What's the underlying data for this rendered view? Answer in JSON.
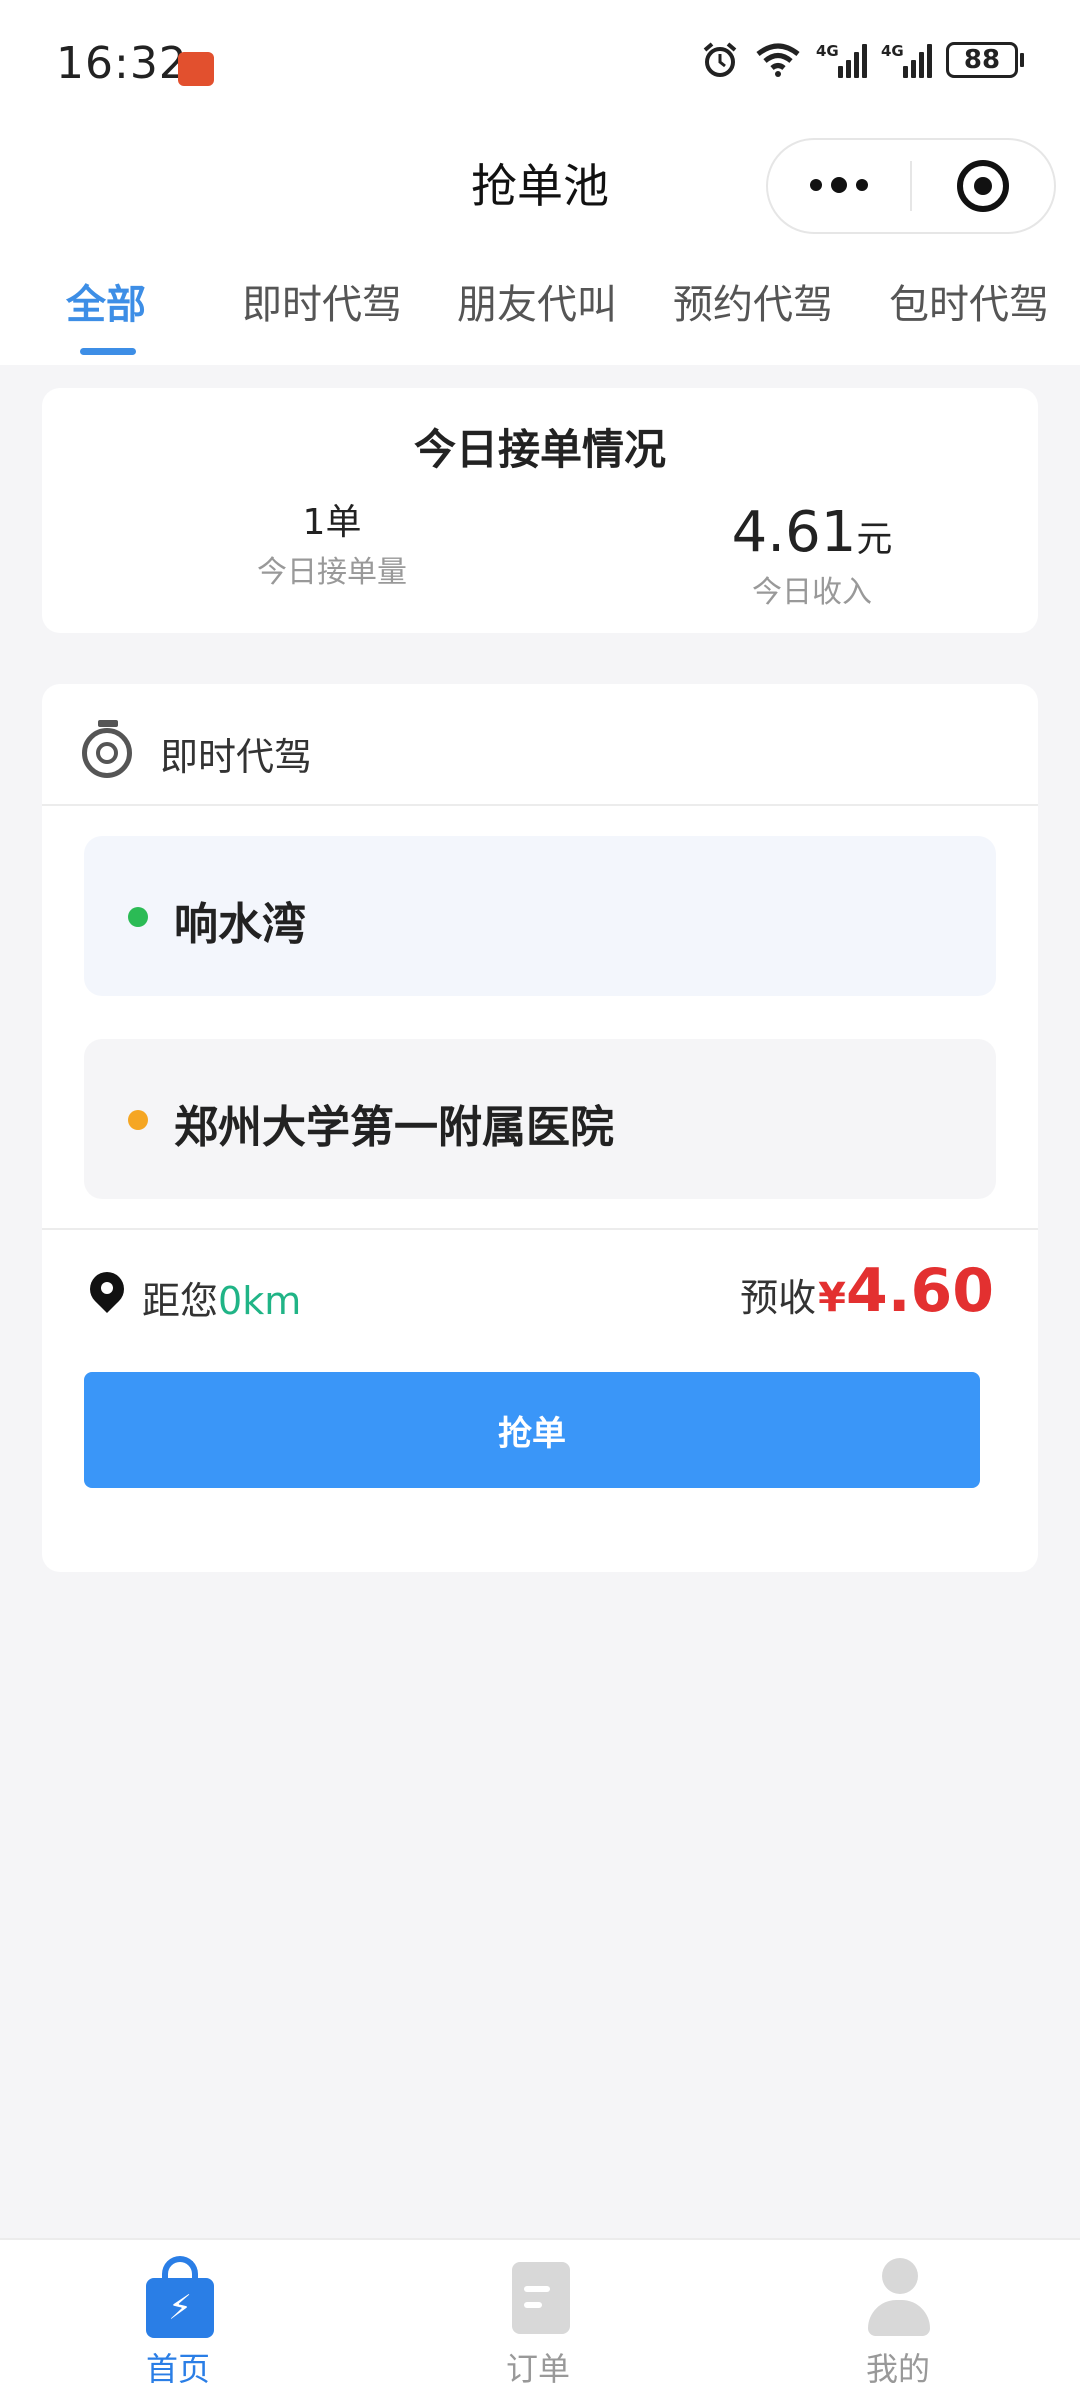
{
  "status_bar": {
    "time": "16:32",
    "network_1": "4G",
    "network_2": "4G",
    "battery": "88",
    "icons": [
      "app-notification-icon",
      "alarm-icon",
      "wifi-icon",
      "signal-icon",
      "signal-icon",
      "battery-icon"
    ]
  },
  "header": {
    "title": "抢单池",
    "capsule_icons": [
      "more-icon",
      "close-target-icon"
    ]
  },
  "tabs": [
    {
      "label": "全部",
      "active": true
    },
    {
      "label": "即时代驾",
      "active": false
    },
    {
      "label": "朋友代叫",
      "active": false
    },
    {
      "label": "预约代驾",
      "active": false
    },
    {
      "label": "包时代驾",
      "active": false
    }
  ],
  "today_stats": {
    "title": "今日接单情况",
    "orders_value": "1单",
    "orders_label": "今日接单量",
    "income_value": "4.61",
    "income_unit": "元",
    "income_label": "今日收入"
  },
  "order": {
    "type": "即时代驾",
    "from": "响水湾",
    "to": "郑州大学第一附属医院",
    "distance_prefix": "距您",
    "distance_value": "0km",
    "fare_prefix": "预收",
    "fare_currency": "¥",
    "fare_amount": "4.60",
    "grab_button": "抢单",
    "colors": {
      "from_dot": "#2bbb55",
      "to_dot": "#f5a623",
      "fare": "#e33030",
      "distance": "#20b486",
      "button": "#3a96f8"
    }
  },
  "tabbar": [
    {
      "label": "首页",
      "icon": "home-bag-icon",
      "active": true
    },
    {
      "label": "订单",
      "icon": "order-doc-icon",
      "active": false
    },
    {
      "label": "我的",
      "icon": "profile-icon",
      "active": false
    }
  ],
  "accent_color": "#3d8ee6"
}
